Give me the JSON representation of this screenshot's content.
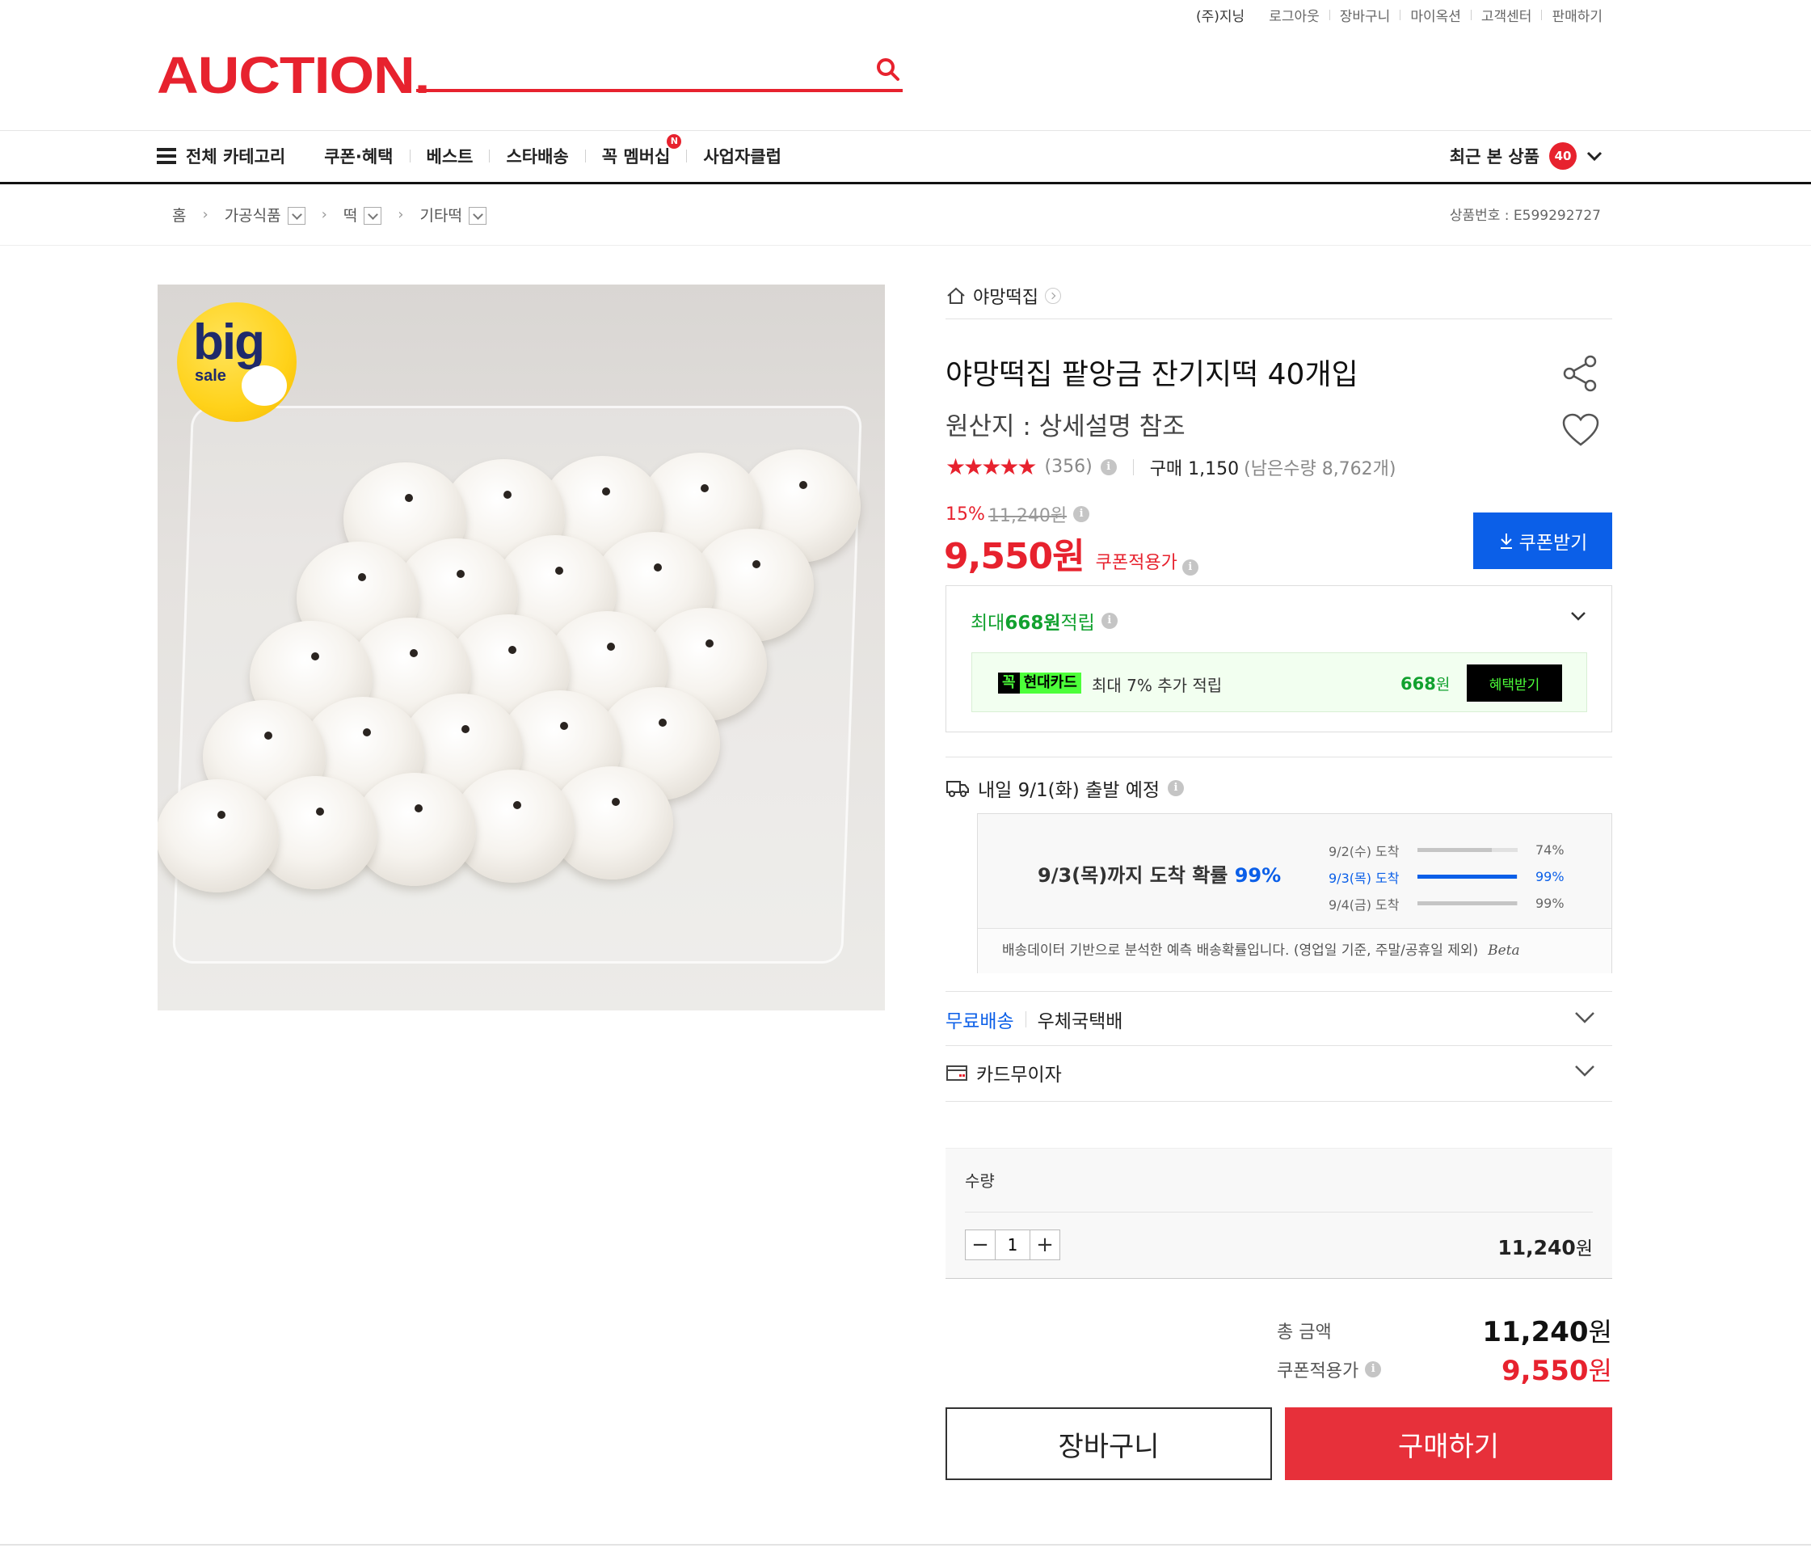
{
  "top_links": {
    "user": "(주)지닝",
    "items": [
      "로그아웃",
      "장바구니",
      "마이옥션",
      "고객센터",
      "판매하기"
    ]
  },
  "header": {
    "logo": "AUCTION.",
    "search_value": "",
    "search_placeholder": ""
  },
  "gnb": {
    "all_categories": "전체 카테고리",
    "items": [
      "쿠폰·혜택",
      "베스트",
      "스타배송",
      "꼭 멤버십",
      "사업자클럽"
    ],
    "new_badge": "N",
    "recent_label": "최근 본 상품",
    "recent_count": "40"
  },
  "breadcrumb": {
    "home": "홈",
    "levels": [
      "가공식품",
      "떡",
      "기타떡"
    ],
    "product_no": "상품번호 : E599292727"
  },
  "product": {
    "image_badge_big": "big",
    "image_badge_sale": "sale",
    "seller": "야망떡집",
    "title": "야망떡집 팥앙금 잔기지떡 40개입",
    "origin": "원산지 : 상세설명 참조",
    "stars": "★★★★★",
    "rating_value": 5,
    "review_count": "(356)",
    "purchase": "구매 1,150",
    "remaining": "(남은수량 8,762개)",
    "discount_pct": "15%",
    "original_price": "11,240원",
    "coupon_price": "9,550원",
    "coupon_price_label": "쿠폰적용가",
    "coupon_button": "쿠폰받기"
  },
  "points": {
    "head_prefix": "최대 ",
    "head_amount": "668원",
    "head_suffix": " 적립",
    "card_logo_1": "꼭",
    "card_logo_2": "현대카드",
    "card_text": "최대 7% 추가 적립",
    "card_amount": "668",
    "card_amount_unit": "원",
    "benefit_button": "혜택받기"
  },
  "shipping": {
    "departure": "내일 9/1(화) 출발 예정",
    "prob_text": "9/3(목)까지 도착 확률 ",
    "prob_value": "99%",
    "rows": [
      {
        "date": "9/2(수) 도착",
        "pct": "74%",
        "value": 74,
        "highlight": false
      },
      {
        "date": "9/3(목) 도착",
        "pct": "99%",
        "value": 99,
        "highlight": true
      },
      {
        "date": "9/4(금) 도착",
        "pct": "99%",
        "value": 99,
        "highlight": false
      }
    ],
    "note": "배송데이터 기반으로 분석한 예측 배송확률입니다. (영업일 기준, 주말/공휴일 제외)",
    "beta": "Beta",
    "free_label": "무료배송",
    "carrier": "우체국택배",
    "installment": "카드무이자"
  },
  "quantity": {
    "label": "수량",
    "value": "1",
    "line_price": "11,240",
    "line_price_unit": "원"
  },
  "totals": {
    "total_label": "총 금액",
    "total_value": "11,240",
    "coupon_label": "쿠폰적용가",
    "coupon_value": "9,550",
    "unit": "원"
  },
  "actions": {
    "cart": "장바구니",
    "buy": "구매하기"
  },
  "colors": {
    "brand_red": "#e7222e",
    "accent_blue": "#0b5fe8",
    "point_green": "#12a12f"
  }
}
